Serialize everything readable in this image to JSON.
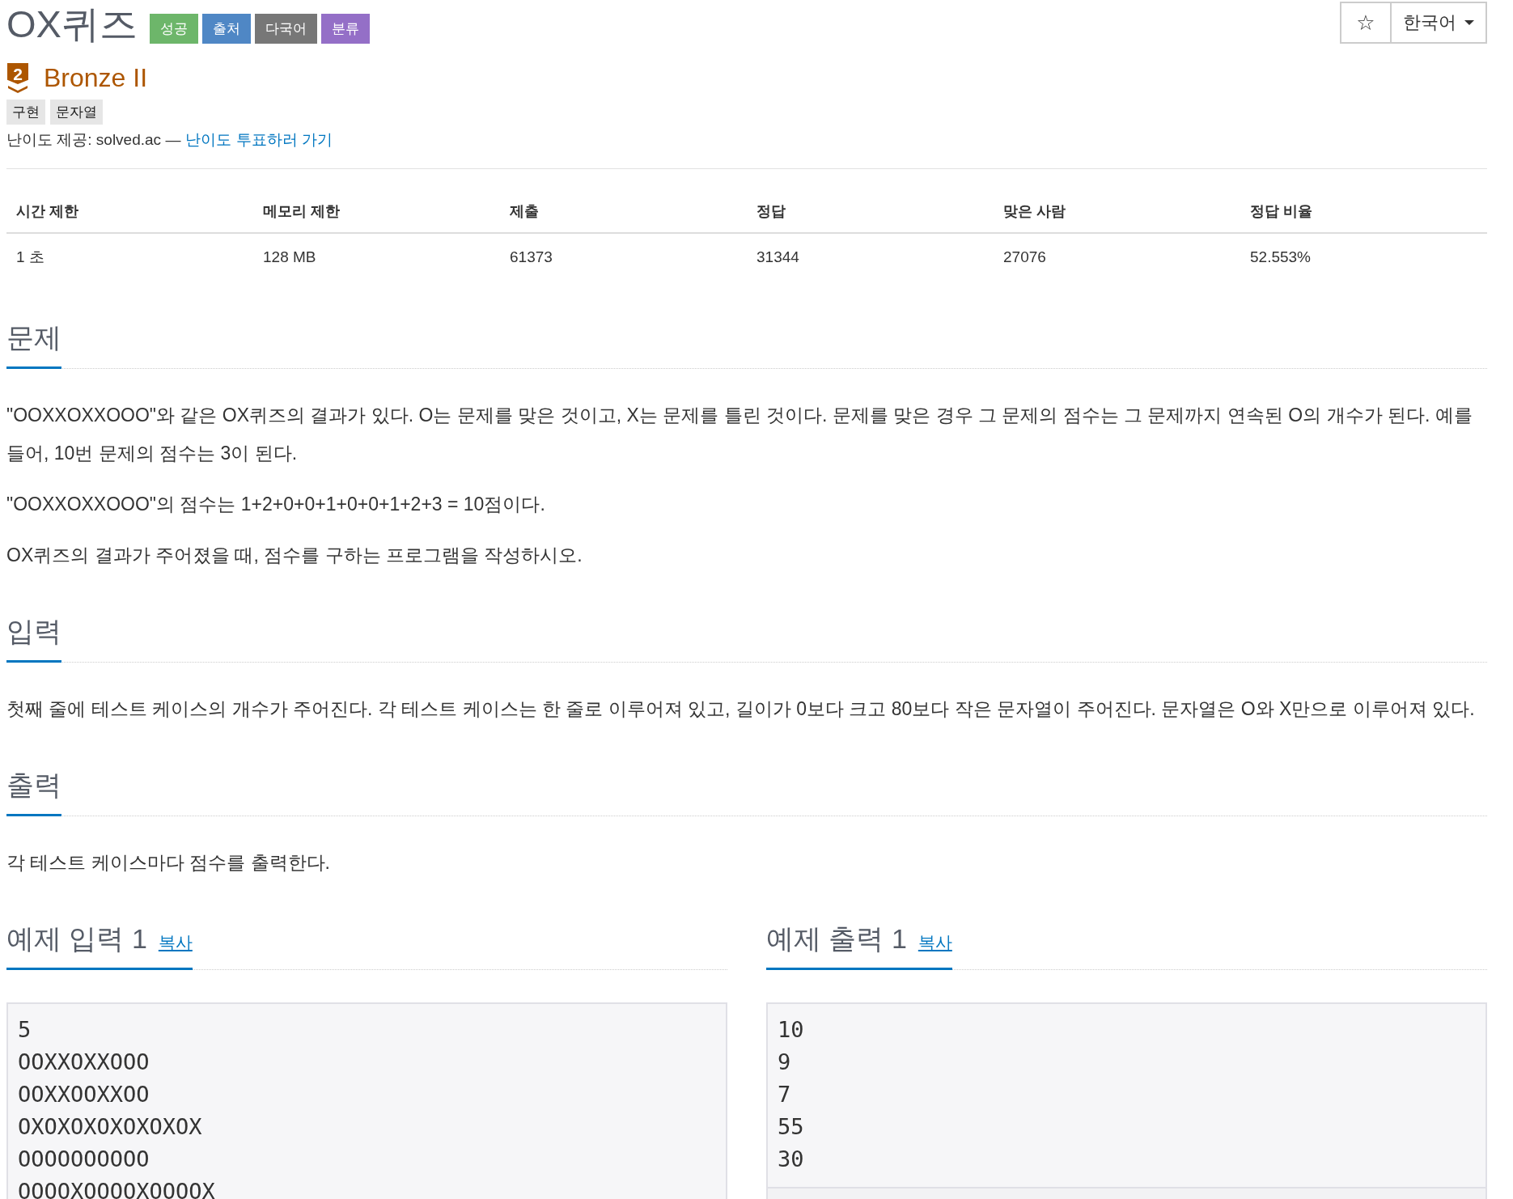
{
  "title": "OX퀴즈",
  "labels": [
    {
      "text": "성공",
      "color": "#6db66a"
    },
    {
      "text": "출처",
      "color": "#4f87c5"
    },
    {
      "text": "다국어",
      "color": "#777777"
    },
    {
      "text": "분류",
      "color": "#946fc7"
    }
  ],
  "toolbar": {
    "star": "☆",
    "language": "한국어"
  },
  "tier": {
    "level": "2",
    "name": "Bronze II"
  },
  "tags": [
    "구현",
    "문자열"
  ],
  "difficulty": {
    "text": "난이도 제공: solved.ac —",
    "link": "난이도 투표하러 가기"
  },
  "table": {
    "columns": [
      "시간 제한",
      "메모리 제한",
      "제출",
      "정답",
      "맞은 사람",
      "정답 비율"
    ],
    "rows": [
      [
        "1 초",
        "128 MB",
        "61373",
        "31344",
        "27076",
        "52.553%"
      ]
    ]
  },
  "sections": [
    {
      "heading": "문제",
      "paragraphs": [
        "\"OOXXOXXOOO\"와 같은 OX퀴즈의 결과가 있다. O는 문제를 맞은 것이고, X는 문제를 틀린 것이다. 문제를 맞은 경우 그 문제의 점수는 그 문제까지 연속된 O의 개수가 된다. 예를 들어, 10번 문제의 점수는 3이 된다.",
        "\"OOXXOXXOOO\"의 점수는 1+2+0+0+1+0+0+1+2+3 = 10점이다.",
        "OX퀴즈의 결과가 주어졌을 때, 점수를 구하는 프로그램을 작성하시오."
      ]
    },
    {
      "heading": "입력",
      "paragraphs": [
        "첫째 줄에 테스트 케이스의 개수가 주어진다. 각 테스트 케이스는 한 줄로 이루어져 있고, 길이가 0보다 크고 80보다 작은 문자열이 주어진다. 문자열은 O와 X만으로 이루어져 있다."
      ]
    },
    {
      "heading": "출력",
      "paragraphs": [
        "각 테스트 케이스마다 점수를 출력한다."
      ]
    }
  ],
  "samples": [
    {
      "heading": "예제 입력 1",
      "copy": "복사",
      "lines": [
        "5",
        "OOXXOXXOOO",
        "OOXXOOXXOO",
        "OXOXOXOXOXOXOX",
        "OOOOOOOOOO",
        "OOOOXOOOOXOOOOX"
      ]
    },
    {
      "heading": "예제 출력 1",
      "copy": "복사",
      "lines": [
        "10",
        "9",
        "7",
        "55",
        "30"
      ]
    }
  ]
}
